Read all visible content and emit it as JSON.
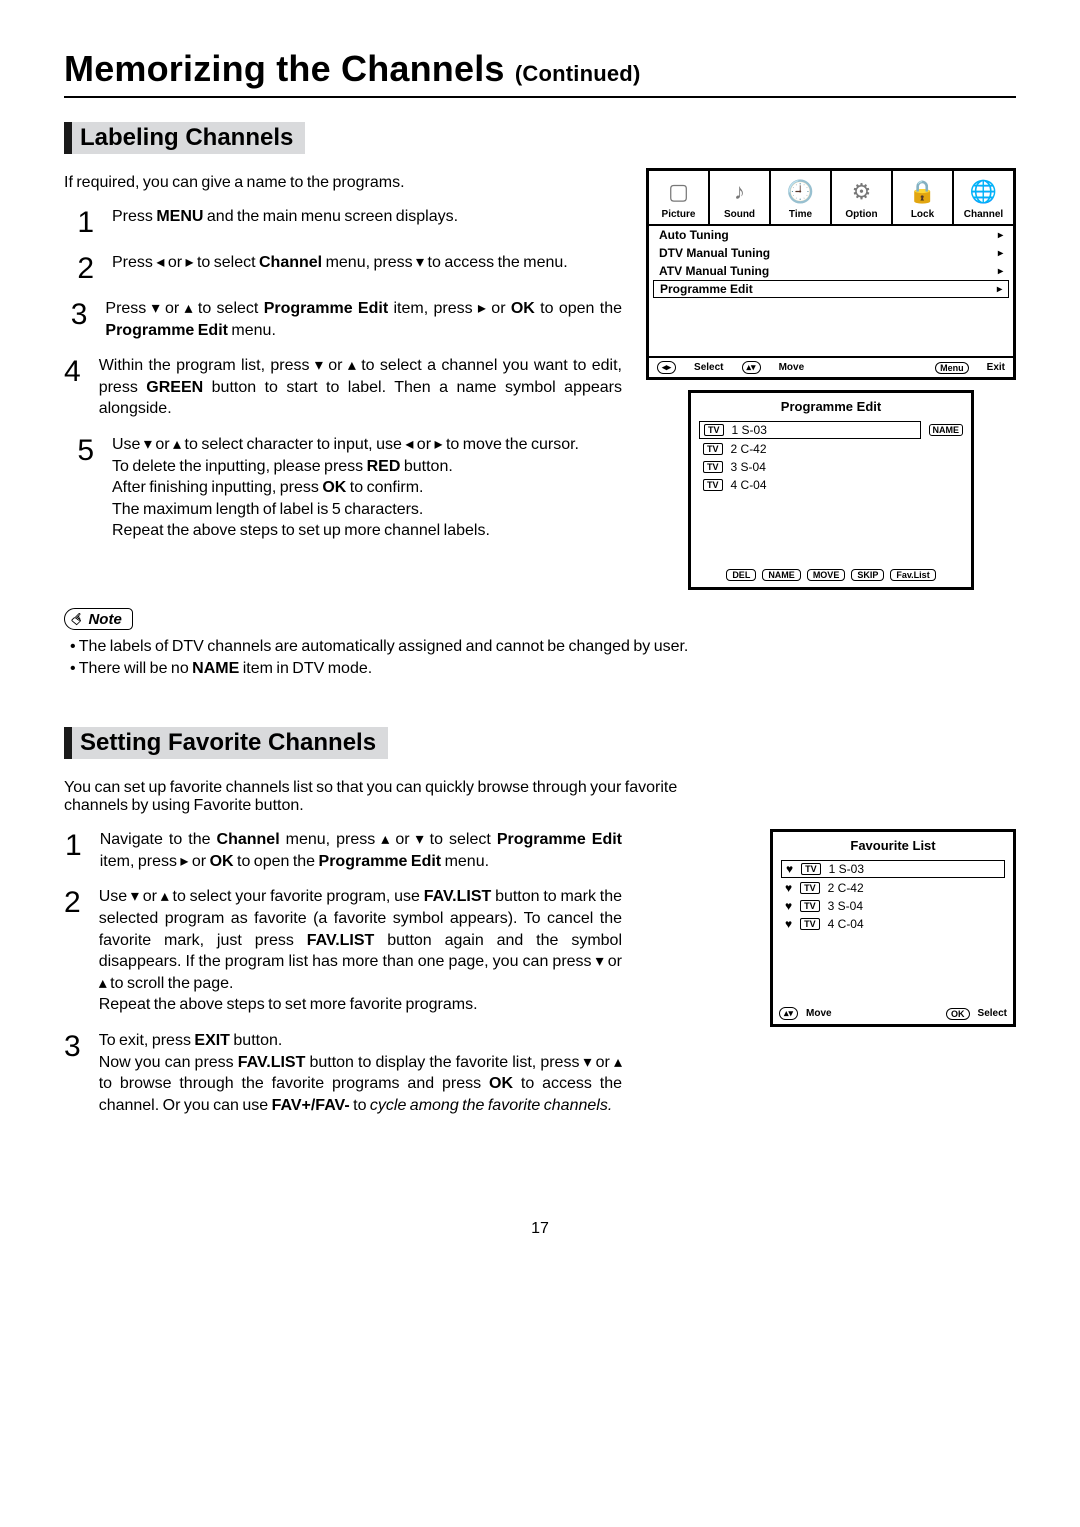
{
  "page_title_main": "Memorizing the Channels ",
  "page_title_cont": "(Continued)",
  "labeling": {
    "heading": "Labeling Channels",
    "intro": "If required, you can give a name to the programs.",
    "steps": {
      "s1_a": "Press ",
      "s1_b": "MENU",
      "s1_c": " and the main menu screen displays.",
      "s2_a": "Press ◂ or ▸ to select ",
      "s2_b": "Channel",
      "s2_c": " menu,  press ▾ to access the menu.",
      "s3_a": "Press ▾ or ▴ to select ",
      "s3_b": "Programme Edit",
      "s3_c": " item, press ▸ or ",
      "s3_d": "OK",
      "s3_e": " to open the ",
      "s3_f": "Programme Edit",
      "s3_g": " menu.",
      "s4_a": "Within the program list,  press ▾ or ▴ to select a channel you want to edit, press ",
      "s4_b": "GREEN",
      "s4_c": " button to start to label. Then a name symbol appears alongside.",
      "s5_a": "Use ▾ or ▴ to select character to input, use ◂ or ▸ to move the cursor.",
      "s5_b": "To delete the inputting, please press ",
      "s5_c": "RED",
      "s5_d": " button.",
      "s5_e": "After finishing inputting, press ",
      "s5_f": "OK",
      "s5_g": " to confirm.",
      "s5_h": "The maximum length of label is 5 characters.",
      "s5_i": "Repeat the above steps to set up more channel labels."
    },
    "note_label": "Note",
    "notes": {
      "n1": "The labels of DTV channels are automatically assigned and cannot be changed by user.",
      "n2_a": "There will be no ",
      "n2_b": "NAME",
      "n2_c": " item in DTV mode."
    }
  },
  "fav": {
    "heading": "Setting Favorite Channels",
    "intro": "You can set up favorite channels list so that you can quickly browse through your favorite channels by using Favorite button.",
    "steps": {
      "s1_a": "Navigate to the ",
      "s1_b": "Channel",
      "s1_c": " menu,  press ▴ or ▾ to select ",
      "s1_d": "Programme Edit",
      "s1_e": " item, press ▸ or ",
      "s1_f": "OK",
      "s1_g": " to open the ",
      "s1_h": "Programme Edit",
      "s1_i": " menu.",
      "s2_a": "Use ▾ or ▴ to select your favorite program, use ",
      "s2_b": "FAV.LIST",
      "s2_c": " button to mark the selected program as favorite (a favorite symbol appears).  To cancel the favorite mark, just press ",
      "s2_d": "FAV.LIST",
      "s2_e": " button again and the symbol disappears. If the program list has more than one page, you can press ▾ or ▴ to scroll the page.",
      "s2_f": "Repeat the above steps to set more favorite programs.",
      "s3_a": "To exit, press ",
      "s3_b": "EXIT",
      "s3_c": " button.",
      "s3_d": "Now you can press ",
      "s3_e": "FAV.LIST",
      "s3_f": " button to display the favorite list, press ▾ or ▴ to browse through the favorite programs and press ",
      "s3_g": "OK",
      "s3_h": " to access the channel. Or you can use ",
      "s3_i": "FAV+/FAV-",
      "s3_j": " to ",
      "s3_k": "cycle among the favorite channels."
    }
  },
  "osd1": {
    "tabs": {
      "picture": "Picture",
      "sound": "Sound",
      "time": "Time",
      "option": "Option",
      "lock": "Lock",
      "channel": "Channel"
    },
    "items": {
      "auto": "Auto Tuning",
      "dtv": "DTV Manual Tuning",
      "atv": "ATV Manual Tuning",
      "pe": "Programme Edit"
    },
    "foot": {
      "select": "Select",
      "move": "Move",
      "menu": "Menu",
      "exit": "Exit"
    }
  },
  "osd2": {
    "title": "Programme Edit",
    "rows": {
      "r1": "1  S-03",
      "r2": "2  C-42",
      "r3": "3  S-04",
      "r4": "4  C-04"
    },
    "side_btn": "NAME",
    "tv": "TV",
    "foot": {
      "del": "DEL",
      "name": "NAME",
      "move": "MOVE",
      "skip": "SKIP",
      "fav": "Fav.List"
    }
  },
  "osd3": {
    "title": "Favourite List",
    "rows": {
      "r1": "1  S-03",
      "r2": "2  C-42",
      "r3": "3  S-04",
      "r4": "4  C-04"
    },
    "tv": "TV",
    "foot": {
      "move": "Move",
      "ok": "OK",
      "select": "Select"
    }
  },
  "page_number": "17"
}
